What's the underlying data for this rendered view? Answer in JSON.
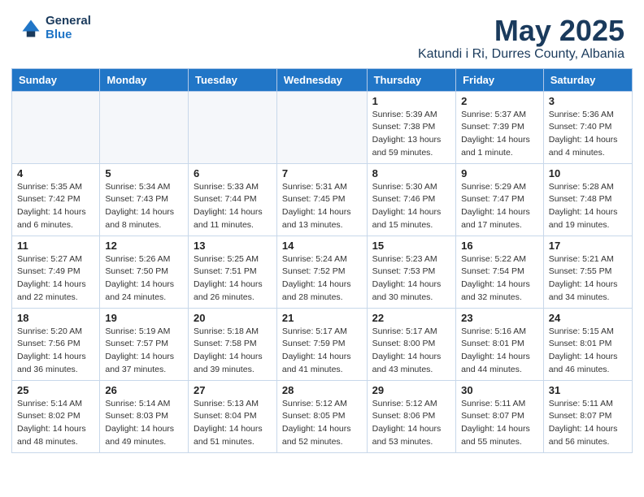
{
  "header": {
    "logo_general": "General",
    "logo_blue": "Blue",
    "main_title": "May 2025",
    "subtitle": "Katundi i Ri, Durres County, Albania"
  },
  "days_of_week": [
    "Sunday",
    "Monday",
    "Tuesday",
    "Wednesday",
    "Thursday",
    "Friday",
    "Saturday"
  ],
  "weeks": [
    [
      {
        "day": "",
        "info": ""
      },
      {
        "day": "",
        "info": ""
      },
      {
        "day": "",
        "info": ""
      },
      {
        "day": "",
        "info": ""
      },
      {
        "day": "1",
        "info": "Sunrise: 5:39 AM\nSunset: 7:38 PM\nDaylight: 13 hours\nand 59 minutes."
      },
      {
        "day": "2",
        "info": "Sunrise: 5:37 AM\nSunset: 7:39 PM\nDaylight: 14 hours\nand 1 minute."
      },
      {
        "day": "3",
        "info": "Sunrise: 5:36 AM\nSunset: 7:40 PM\nDaylight: 14 hours\nand 4 minutes."
      }
    ],
    [
      {
        "day": "4",
        "info": "Sunrise: 5:35 AM\nSunset: 7:42 PM\nDaylight: 14 hours\nand 6 minutes."
      },
      {
        "day": "5",
        "info": "Sunrise: 5:34 AM\nSunset: 7:43 PM\nDaylight: 14 hours\nand 8 minutes."
      },
      {
        "day": "6",
        "info": "Sunrise: 5:33 AM\nSunset: 7:44 PM\nDaylight: 14 hours\nand 11 minutes."
      },
      {
        "day": "7",
        "info": "Sunrise: 5:31 AM\nSunset: 7:45 PM\nDaylight: 14 hours\nand 13 minutes."
      },
      {
        "day": "8",
        "info": "Sunrise: 5:30 AM\nSunset: 7:46 PM\nDaylight: 14 hours\nand 15 minutes."
      },
      {
        "day": "9",
        "info": "Sunrise: 5:29 AM\nSunset: 7:47 PM\nDaylight: 14 hours\nand 17 minutes."
      },
      {
        "day": "10",
        "info": "Sunrise: 5:28 AM\nSunset: 7:48 PM\nDaylight: 14 hours\nand 19 minutes."
      }
    ],
    [
      {
        "day": "11",
        "info": "Sunrise: 5:27 AM\nSunset: 7:49 PM\nDaylight: 14 hours\nand 22 minutes."
      },
      {
        "day": "12",
        "info": "Sunrise: 5:26 AM\nSunset: 7:50 PM\nDaylight: 14 hours\nand 24 minutes."
      },
      {
        "day": "13",
        "info": "Sunrise: 5:25 AM\nSunset: 7:51 PM\nDaylight: 14 hours\nand 26 minutes."
      },
      {
        "day": "14",
        "info": "Sunrise: 5:24 AM\nSunset: 7:52 PM\nDaylight: 14 hours\nand 28 minutes."
      },
      {
        "day": "15",
        "info": "Sunrise: 5:23 AM\nSunset: 7:53 PM\nDaylight: 14 hours\nand 30 minutes."
      },
      {
        "day": "16",
        "info": "Sunrise: 5:22 AM\nSunset: 7:54 PM\nDaylight: 14 hours\nand 32 minutes."
      },
      {
        "day": "17",
        "info": "Sunrise: 5:21 AM\nSunset: 7:55 PM\nDaylight: 14 hours\nand 34 minutes."
      }
    ],
    [
      {
        "day": "18",
        "info": "Sunrise: 5:20 AM\nSunset: 7:56 PM\nDaylight: 14 hours\nand 36 minutes."
      },
      {
        "day": "19",
        "info": "Sunrise: 5:19 AM\nSunset: 7:57 PM\nDaylight: 14 hours\nand 37 minutes."
      },
      {
        "day": "20",
        "info": "Sunrise: 5:18 AM\nSunset: 7:58 PM\nDaylight: 14 hours\nand 39 minutes."
      },
      {
        "day": "21",
        "info": "Sunrise: 5:17 AM\nSunset: 7:59 PM\nDaylight: 14 hours\nand 41 minutes."
      },
      {
        "day": "22",
        "info": "Sunrise: 5:17 AM\nSunset: 8:00 PM\nDaylight: 14 hours\nand 43 minutes."
      },
      {
        "day": "23",
        "info": "Sunrise: 5:16 AM\nSunset: 8:01 PM\nDaylight: 14 hours\nand 44 minutes."
      },
      {
        "day": "24",
        "info": "Sunrise: 5:15 AM\nSunset: 8:01 PM\nDaylight: 14 hours\nand 46 minutes."
      }
    ],
    [
      {
        "day": "25",
        "info": "Sunrise: 5:14 AM\nSunset: 8:02 PM\nDaylight: 14 hours\nand 48 minutes."
      },
      {
        "day": "26",
        "info": "Sunrise: 5:14 AM\nSunset: 8:03 PM\nDaylight: 14 hours\nand 49 minutes."
      },
      {
        "day": "27",
        "info": "Sunrise: 5:13 AM\nSunset: 8:04 PM\nDaylight: 14 hours\nand 51 minutes."
      },
      {
        "day": "28",
        "info": "Sunrise: 5:12 AM\nSunset: 8:05 PM\nDaylight: 14 hours\nand 52 minutes."
      },
      {
        "day": "29",
        "info": "Sunrise: 5:12 AM\nSunset: 8:06 PM\nDaylight: 14 hours\nand 53 minutes."
      },
      {
        "day": "30",
        "info": "Sunrise: 5:11 AM\nSunset: 8:07 PM\nDaylight: 14 hours\nand 55 minutes."
      },
      {
        "day": "31",
        "info": "Sunrise: 5:11 AM\nSunset: 8:07 PM\nDaylight: 14 hours\nand 56 minutes."
      }
    ]
  ]
}
